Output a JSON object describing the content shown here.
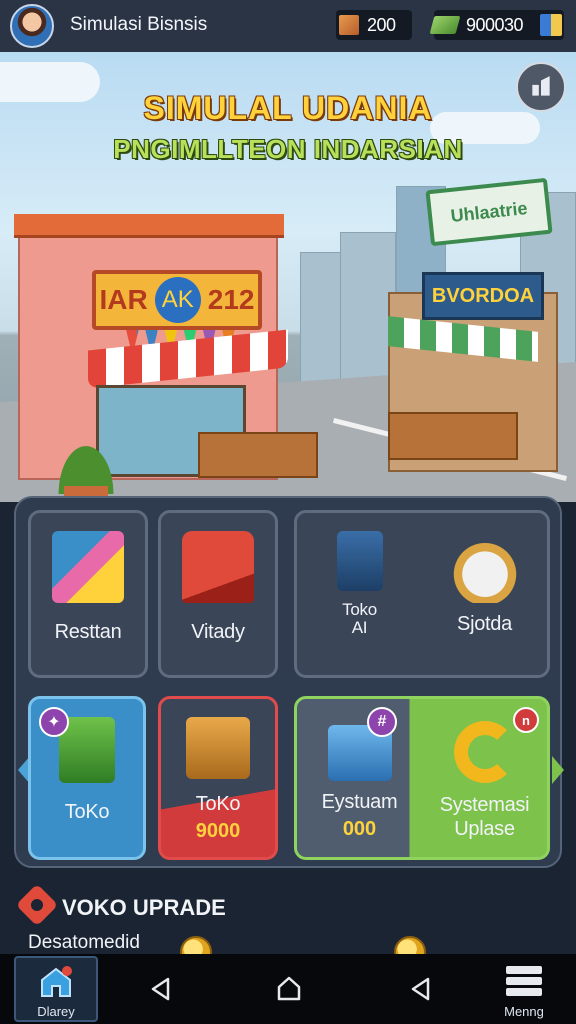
{
  "header": {
    "title": "Simulasi Bisnsis",
    "resource_1": {
      "icon": "crate-icon",
      "value": "200"
    },
    "resource_2": {
      "icon": "cash-icon",
      "value": "900030"
    },
    "flag_icon": "flag-icon"
  },
  "scene": {
    "title_line_1": "SIMULAL UDANIA",
    "title_line_2": "PNGIMLLTEON INDARSIAN",
    "main_shop_sign_left": "IAR",
    "main_shop_sign_center": "AK",
    "main_shop_sign_right": "212",
    "right_shop_sign": "BVORDOA",
    "background_sign": "Uhlaatrie",
    "corner_button_icon": "build-icon"
  },
  "tiles": {
    "row1": [
      {
        "label": "Resttan",
        "icon": "snack-goods-icon"
      },
      {
        "label": "Vitady",
        "icon": "red-sofa-icon"
      },
      {
        "label": "Toko\nAI",
        "icon": "blue-cabinet-icon"
      },
      {
        "label": "Sjotda",
        "icon": "grocery-basket-icon"
      }
    ],
    "row2": [
      {
        "label": "ToKo",
        "icon": "green-box-icon",
        "badge_icon": "hammer-icon"
      },
      {
        "label": "ToKo",
        "value": "9000",
        "icon": "cash-register-icon"
      },
      {
        "label": "Eystuam",
        "value": "000",
        "icon": "blue-crate-icon",
        "badge_icon": "hashtag-icon"
      },
      {
        "label": "Systemasi\nUplase",
        "icon": "gold-c-icon",
        "badge_icon": "info-icon"
      }
    ]
  },
  "upgrade": {
    "title": "VOKO UPRADE",
    "subtitle": "Desatomedid"
  },
  "nav": {
    "home_label": "Dlarey",
    "menu_label": "Menng"
  },
  "colors": {
    "panel_bg": "#2f3b4f",
    "tile_blue": "#3b8fc8",
    "tile_red_border": "#e14b4b",
    "tile_green": "#7dc24b",
    "gold": "#ffd23c"
  }
}
